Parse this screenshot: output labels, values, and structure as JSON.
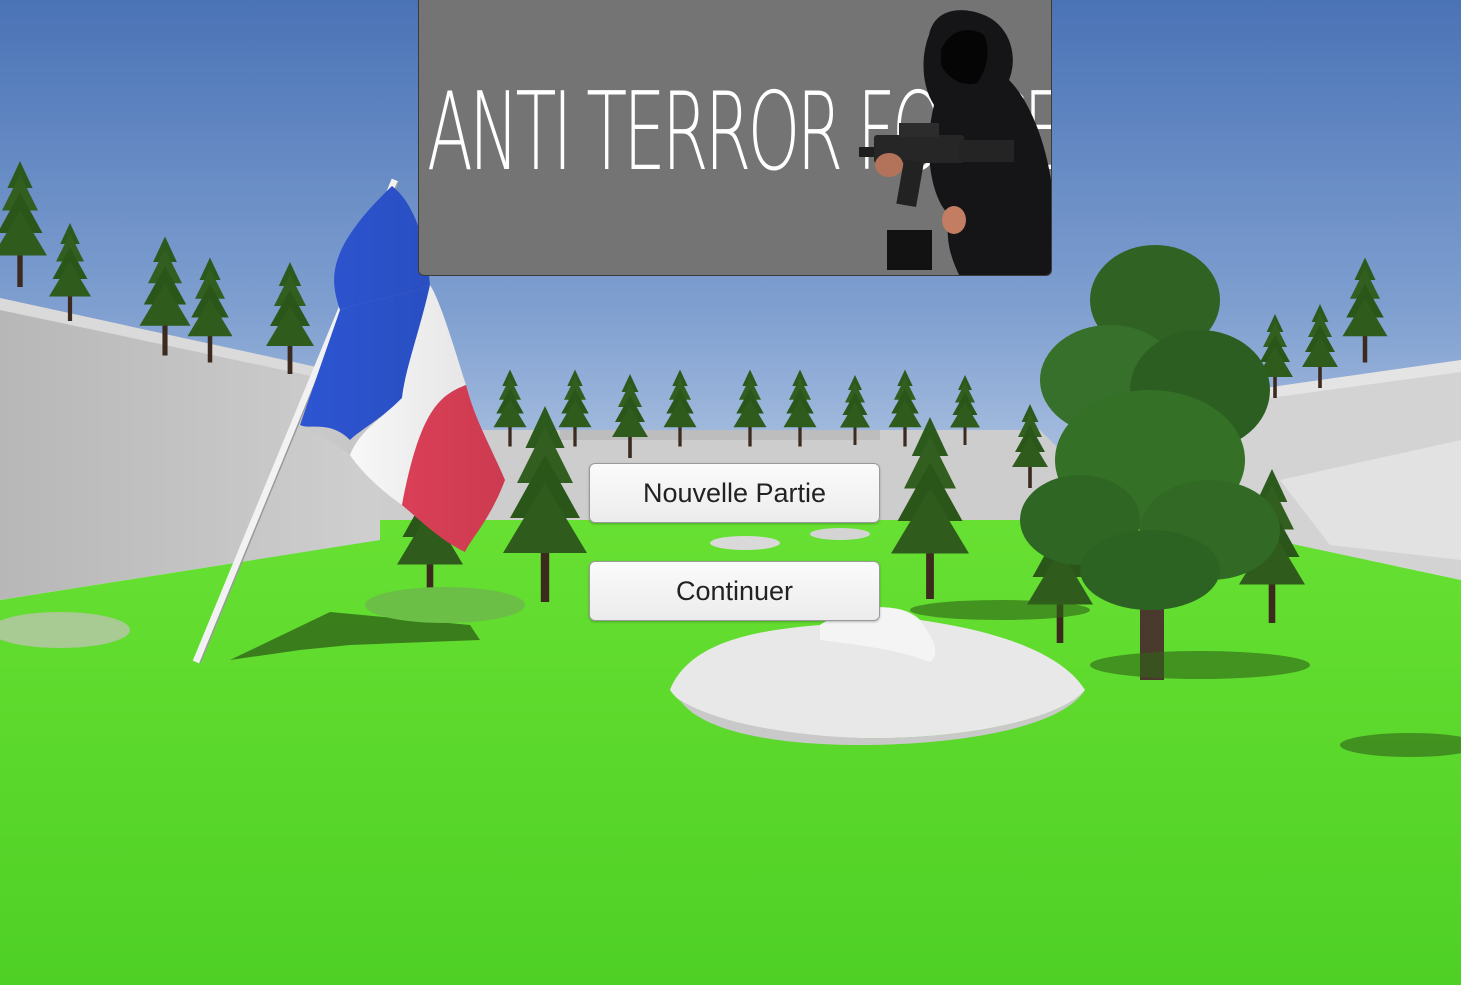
{
  "title": {
    "text": "ANTI TERROR FORCE"
  },
  "menu": {
    "new_game_label": "Nouvelle Partie",
    "continue_label": "Continuer"
  },
  "colors": {
    "sky_top": "#4a74b8",
    "sky_horizon": "#b9cce6",
    "grass": "#5fdc2e",
    "panel": "#747474",
    "flag_blue": "#2d55d0",
    "flag_white": "#ffffff",
    "flag_red": "#e8435a"
  }
}
